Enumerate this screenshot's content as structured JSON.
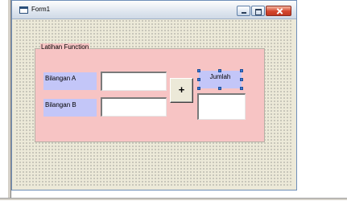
{
  "window": {
    "title": "Form1"
  },
  "frame": {
    "caption": "Latihan Function"
  },
  "labels": {
    "bilangan_a": "Bilangan A",
    "bilangan_b": "Bilangan B",
    "jumlah": "Jumlah"
  },
  "inputs": {
    "bilangan_a": "",
    "bilangan_b": "",
    "jumlah": ""
  },
  "button": {
    "plus_label": "+"
  },
  "colors": {
    "frame_background": "#f7c4c4",
    "label_background": "#c3c6f8",
    "selection_handle": "#3a7bd5"
  },
  "icons": {
    "window": "form-icon",
    "minimize": "minimize-icon",
    "maximize": "maximize-icon",
    "close": "close-icon"
  },
  "selected_control": "jumlah-label"
}
